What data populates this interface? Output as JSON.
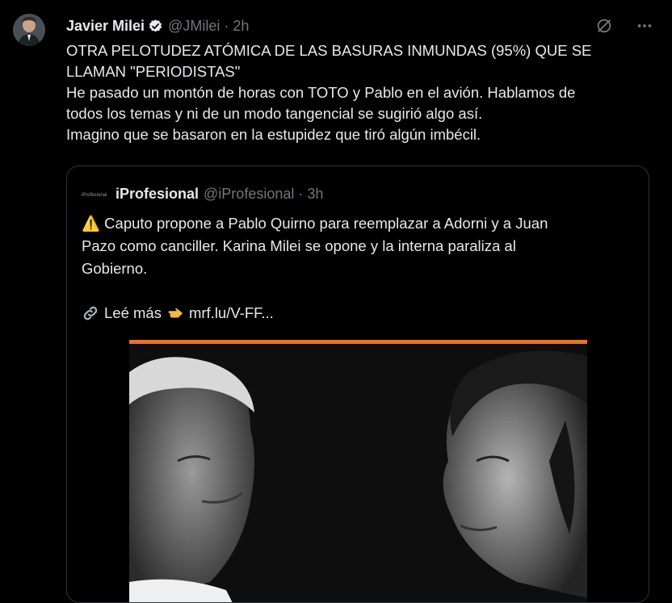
{
  "author": {
    "name": "Javier Milei",
    "handle": "@JMilei",
    "separator": "·",
    "time": "2h",
    "verified_icon": "verified-badge-icon"
  },
  "actions": {
    "grok_icon": "grok-icon",
    "more_icon": "more-options-icon"
  },
  "tweet": {
    "lines": [
      "OTRA PELOTUDEZ ATÓMICA DE LAS BASURAS INMUNDAS (95%) QUE SE",
      "LLAMAN \"PERIODISTAS\"",
      "He pasado un montón de horas con TOTO y Pablo en el avión. Hablamos de",
      "todos los temas y ni de un modo tangencial se sugirió algo así.",
      "Imagino que se basaron en la estupidez que tiró algún imbécil."
    ]
  },
  "quote": {
    "name": "iProfesional",
    "handle": "@iProfesional",
    "separator": "·",
    "time": "3h",
    "avatar_text": "iProfesional",
    "lines": [
      "⚠️ Caputo propone a Pablo Quirno para reemplazar a Adorni y a Juan",
      "Pazo como canciller. Karina Milei se opone y la interna paraliza al",
      "Gobierno."
    ],
    "link_prefix": "Leé más",
    "link_url": "mrf.lu/V-FF...",
    "link_icon": "link-icon",
    "pointing_icon": "pointing-right-icon"
  },
  "colors": {
    "background": "#000000",
    "text": "#e7e9ea",
    "muted": "#71767b",
    "verified": "#1d9bf0",
    "accent_bar": "#e8742a",
    "border": "#2f3336"
  }
}
